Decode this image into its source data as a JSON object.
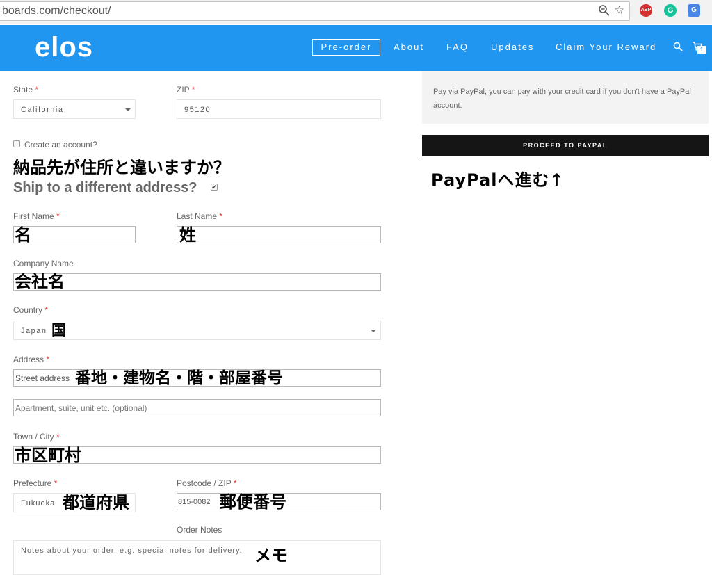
{
  "browser": {
    "url": "boards.com/checkout/",
    "icons": [
      "zoom-icon",
      "star-icon",
      "adblock-icon",
      "grammarly-icon",
      "translate-icon"
    ],
    "abp_label": "ABP"
  },
  "header": {
    "logo": "elos",
    "nav": [
      "Pre-order",
      "About",
      "FAQ",
      "Updates",
      "Claim Your Reward"
    ],
    "cart_count": "1",
    "bg_color": "#2196f0"
  },
  "form": {
    "state": {
      "label": "State",
      "required": "*",
      "value": "California"
    },
    "zip": {
      "label": "ZIP",
      "required": "*",
      "value": "95120"
    },
    "create_account": "Create an account?",
    "ship_annotation": "納品先が住所と違いますか？",
    "ship_different": "Ship to a different address?",
    "first_name": {
      "label": "First Name",
      "required": "*",
      "annotation": "名"
    },
    "last_name": {
      "label": "Last Name",
      "required": "*",
      "annotation": "姓"
    },
    "company": {
      "label": "Company Name",
      "annotation": "会社名"
    },
    "country": {
      "label": "Country",
      "required": "*",
      "value": "Japan",
      "annotation": "国"
    },
    "address": {
      "label": "Address",
      "required": "*",
      "street_placeholder": "Street address",
      "annotation": "番地・建物名・階・部屋番号",
      "apt_placeholder": "Apartment, suite, unit etc. (optional)"
    },
    "city": {
      "label": "Town / City",
      "required": "*",
      "annotation": "市区町村"
    },
    "prefecture": {
      "label": "Prefecture",
      "required": "*",
      "value": "Fukuoka",
      "annotation": "都道府県"
    },
    "postcode": {
      "label": "Postcode / ZIP",
      "required": "*",
      "value": "815-0082",
      "annotation": "郵便番号"
    },
    "notes": {
      "label": "Order Notes",
      "placeholder": "Notes about your order, e.g. special notes for delivery.",
      "annotation": "メモ"
    }
  },
  "payment": {
    "description": "Pay via PayPal; you can pay with your credit card if you don't have a PayPal account.",
    "button": "PROCEED TO PAYPAL",
    "annotation": "PayPalへ進む↑"
  }
}
